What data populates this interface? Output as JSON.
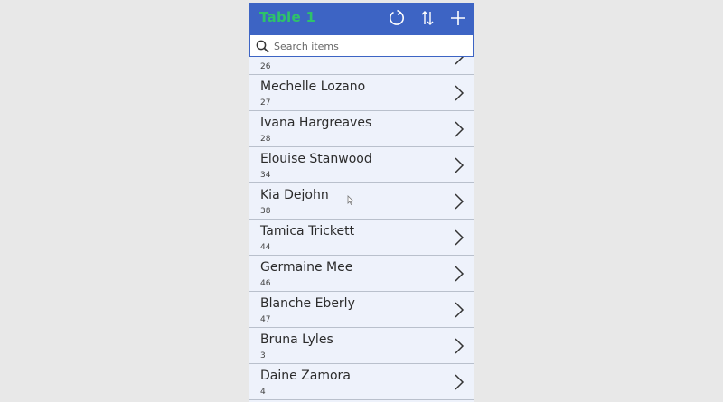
{
  "app": {
    "title": "Table 1",
    "icons": {
      "refresh": "refresh-icon",
      "sort": "sort-icon",
      "add": "plus-icon",
      "search": "search-icon",
      "next": "chevron-right-icon"
    },
    "colors": {
      "header": "#3d64c4",
      "title": "#2ec26a",
      "list_background": "#eef2fb"
    }
  },
  "search": {
    "placeholder": "Search items",
    "value": ""
  },
  "items": [
    {
      "name": "",
      "subtitle": "26"
    },
    {
      "name": "Mechelle Lozano",
      "subtitle": "27"
    },
    {
      "name": "Ivana Hargreaves",
      "subtitle": "28"
    },
    {
      "name": "Elouise Stanwood",
      "subtitle": "34"
    },
    {
      "name": "Kia Dejohn",
      "subtitle": "38"
    },
    {
      "name": "Tamica Trickett",
      "subtitle": "44"
    },
    {
      "name": "Germaine Mee",
      "subtitle": "46"
    },
    {
      "name": "Blanche Eberly",
      "subtitle": "47"
    },
    {
      "name": "Bruna Lyles",
      "subtitle": "3"
    },
    {
      "name": "Daine Zamora",
      "subtitle": "4"
    }
  ]
}
